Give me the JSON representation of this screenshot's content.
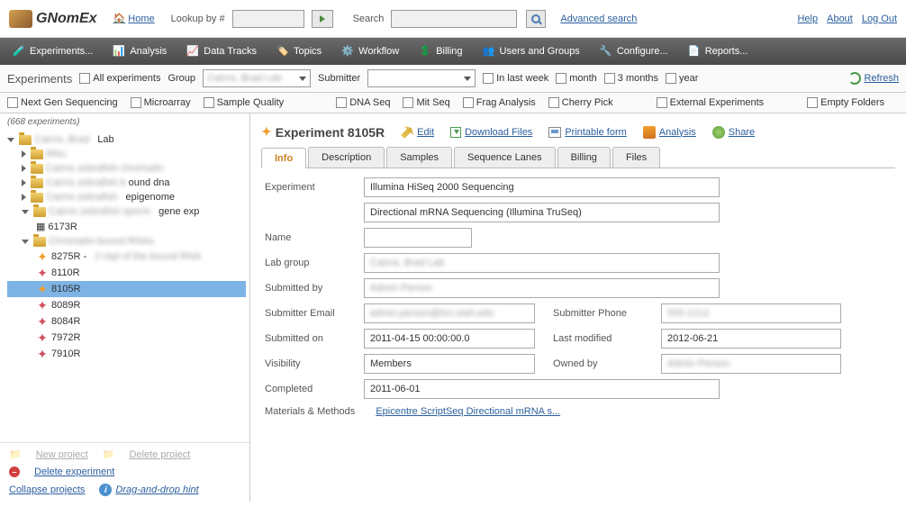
{
  "header": {
    "app_name": "GNomEx",
    "home": "Home",
    "lookup_label": "Lookup by #",
    "search_label": "Search",
    "adv_search": "Advanced search",
    "help": "Help",
    "about": "About",
    "logout": "Log Out"
  },
  "nav": {
    "experiments": "Experiments...",
    "analysis": "Analysis",
    "data_tracks": "Data Tracks",
    "topics": "Topics",
    "workflow": "Workflow",
    "billing": "Billing",
    "users_groups": "Users and Groups",
    "configure": "Configure...",
    "reports": "Reports..."
  },
  "toolbar": {
    "title": "Experiments",
    "all_exp": "All experiments",
    "group_label": "Group",
    "submitter_label": "Submitter",
    "last_week": "In last week",
    "month": "month",
    "three_months": "3 months",
    "year": "year",
    "refresh": "Refresh"
  },
  "filters": {
    "ngs": "Next Gen Sequencing",
    "microarray": "Microarray",
    "sample_qual": "Sample Quality",
    "dna_seq": "DNA Seq",
    "mit_seq": "Mit Seq",
    "frag": "Frag Analysis",
    "cherry": "Cherry Pick",
    "ext_exp": "External Experiments",
    "empty": "Empty Folders"
  },
  "sidebar": {
    "count": "(668 experiments)",
    "tree": {
      "lab": "Lab",
      "bound_dna": "ound dna",
      "epigenome": "epigenome",
      "gene_exp": "gene exp",
      "n_6173R": "6173R",
      "n_8275R": "8275R -",
      "n_8110R": "8110R",
      "n_8105R": "8105R",
      "n_8089R": "8089R",
      "n_8084R": "8084R",
      "n_7972R": "7972R",
      "n_7910R": "7910R"
    },
    "new_project": "New project",
    "delete_project": "Delete project",
    "delete_exp": "Delete experiment",
    "collapse": "Collapse projects",
    "drag_hint": "Drag-and-drop hint"
  },
  "detail": {
    "title": "Experiment 8105R",
    "edit": "Edit",
    "download": "Download Files",
    "printable": "Printable form",
    "analysis": "Analysis",
    "share": "Share",
    "tabs": {
      "info": "Info",
      "description": "Description",
      "samples": "Samples",
      "seq_lanes": "Sequence Lanes",
      "billing": "Billing",
      "files": "Files"
    },
    "form": {
      "experiment_label": "Experiment",
      "experiment_val": "Illumina HiSeq 2000 Sequencing",
      "experiment_val2": "Directional mRNA Sequencing (Illumina TruSeq)",
      "name_label": "Name",
      "name_val": "",
      "lab_group_label": "Lab group",
      "submitted_by_label": "Submitted by",
      "sub_email_label": "Submitter Email",
      "sub_phone_label": "Submitter Phone",
      "submitted_on_label": "Submitted on",
      "submitted_on_val": "2011-04-15 00:00:00.0",
      "last_mod_label": "Last modified",
      "last_mod_val": "2012-06-21",
      "visibility_label": "Visibility",
      "visibility_val": "Members",
      "owned_by_label": "Owned by",
      "completed_label": "Completed",
      "completed_val": "2011-06-01",
      "mm_label": "Materials & Methods",
      "mm_link": "Epicentre ScriptSeq Directional mRNA s..."
    }
  }
}
